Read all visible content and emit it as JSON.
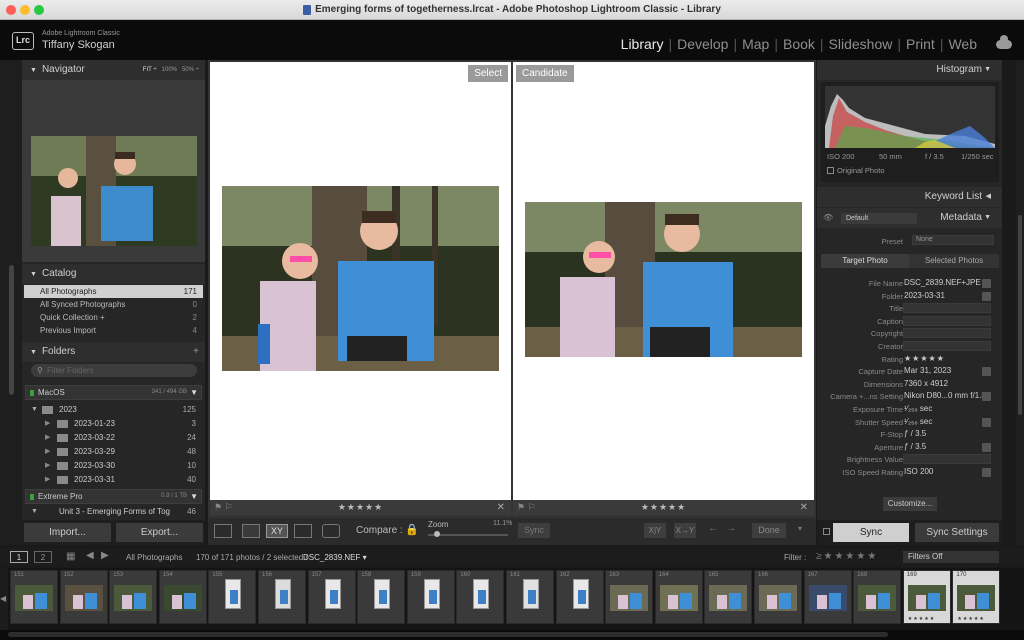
{
  "window": {
    "title": "Emerging forms of togetherness.lrcat - Adobe Photoshop Lightroom Classic - Library"
  },
  "header": {
    "app": "Adobe Lightroom Classic",
    "user": "Tiffany Skogan",
    "logo": "Lrc",
    "modules": [
      "Library",
      "Develop",
      "Map",
      "Book",
      "Slideshow",
      "Print",
      "Web"
    ],
    "active": "Library"
  },
  "navigator": {
    "title": "Navigator",
    "zooms": [
      "FIT ÷",
      "100%",
      "50% ÷"
    ]
  },
  "catalog": {
    "title": "Catalog",
    "items": [
      {
        "label": "All Photographs",
        "count": "171"
      },
      {
        "label": "All Synced Photographs",
        "count": "0"
      },
      {
        "label": "Quick Collection +",
        "count": "2"
      },
      {
        "label": "Previous Import",
        "count": "4"
      }
    ]
  },
  "folders": {
    "title": "Folders",
    "filter_placeholder": "Filter Folders",
    "volume1": {
      "name": "MacOS",
      "size": "341 / 494 GB"
    },
    "year": {
      "name": "2023",
      "count": "125"
    },
    "subfolders": [
      {
        "name": "2023-01-23",
        "count": "3"
      },
      {
        "name": "2023-03-22",
        "count": "24"
      },
      {
        "name": "2023-03-29",
        "count": "48"
      },
      {
        "name": "2023-03-30",
        "count": "10"
      },
      {
        "name": "2023-03-31",
        "count": "40"
      }
    ],
    "volume2": {
      "name": "Extreme Pro",
      "size": "0.9 / 1 TB"
    },
    "unit": {
      "name": "Unit 3 - Emerging Forms of Tog",
      "count": "46"
    }
  },
  "left_buttons": {
    "import": "Import...",
    "export": "Export..."
  },
  "compare": {
    "select": "Select",
    "candidate": "Candidate",
    "stars": "★★★★★"
  },
  "toolbar": {
    "compare": "Compare :",
    "zoom": "Zoom",
    "zoom_value": "11.1%",
    "sync": "Sync",
    "done": "Done",
    "xy1": "X|Y",
    "xy2": "X→Y"
  },
  "histogram": {
    "title": "Histogram",
    "iso": "ISO 200",
    "focal": "50 mm",
    "fstop": "f / 3.5",
    "shutter": "1/250 sec",
    "original": "Original Photo"
  },
  "keyword_list": {
    "title": "Keyword List"
  },
  "metadata": {
    "title": "Metadata",
    "preset_menu": "Default",
    "preset_label": "Preset",
    "preset_value": "None",
    "tab_target": "Target Photo",
    "tab_selected": "Selected Photos",
    "fields": [
      {
        "label": "File Name",
        "value": "DSC_2839.NEF+JPE"
      },
      {
        "label": "Folder",
        "value": "2023-03-31"
      },
      {
        "label": "Title",
        "value": ""
      },
      {
        "label": "Caption",
        "value": ""
      },
      {
        "label": "Copyright",
        "value": ""
      },
      {
        "label": "Creator",
        "value": ""
      },
      {
        "label": "Rating",
        "value": "★★★★★"
      },
      {
        "label": "Capture Date",
        "value": "Mar 31, 2023"
      },
      {
        "label": "Dimensions",
        "value": "7360 x 4912"
      },
      {
        "label": "Camera +...ns Setting",
        "value": "Nikon D80...0 mm f/1.8)"
      },
      {
        "label": "Exposure Time",
        "value": "¹⁄₂₅₀ sec"
      },
      {
        "label": "Shutter Speed",
        "value": "¹⁄₂₅₀ sec"
      },
      {
        "label": "F-Stop",
        "value": "ƒ / 3.5"
      },
      {
        "label": "Aperture",
        "value": "ƒ / 3.5"
      },
      {
        "label": "Brightness Value",
        "value": ""
      },
      {
        "label": "ISO Speed Rating",
        "value": "ISO 200"
      }
    ],
    "customize": "Customize..."
  },
  "right_buttons": {
    "sync": "Sync",
    "sync_settings": "Sync Settings"
  },
  "filmstrip": {
    "pages": [
      "1",
      "2"
    ],
    "source": "All Photographs",
    "info": "170 of 171 photos / 2 selected /",
    "file": "DSC_2839.NEF ▾",
    "filter_label": "Filter :",
    "filter_value": "Filters Off",
    "numbers": [
      "151",
      "152",
      "153",
      "154",
      "155",
      "156",
      "157",
      "158",
      "159",
      "160",
      "161",
      "162",
      "163",
      "164",
      "165",
      "166",
      "167",
      "168",
      "169",
      "170"
    ]
  }
}
